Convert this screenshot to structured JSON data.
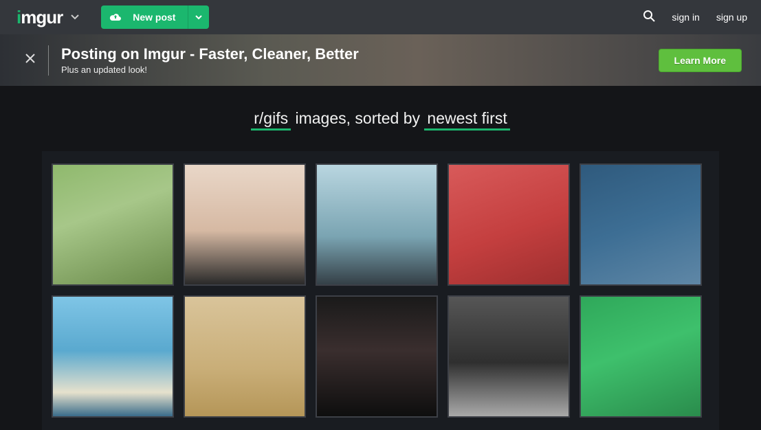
{
  "topbar": {
    "logo_prefix": "i",
    "logo_rest": "mgur",
    "new_post_label": "New post",
    "signin": "sign in",
    "signup": "sign up"
  },
  "banner": {
    "title": "Posting on Imgur - Faster, Cleaner, Better",
    "subtitle": "Plus an updated look!",
    "cta": "Learn More"
  },
  "heading": {
    "subreddit": "r/gifs",
    "middle": " images, sorted by ",
    "sort": "newest first"
  }
}
